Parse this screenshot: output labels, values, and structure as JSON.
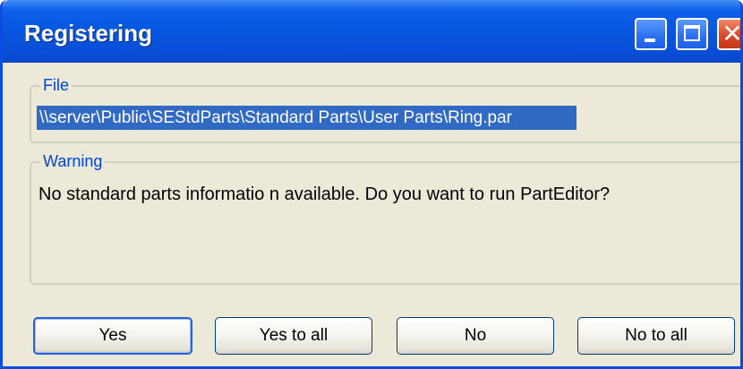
{
  "window": {
    "title": "Registering",
    "controls": {
      "minimize_icon": "minimize-icon",
      "maximize_icon": "maximize-icon",
      "close_icon": "close-icon",
      "close_glyph": "✕"
    }
  },
  "file_group": {
    "legend": "File",
    "path": "\\\\server\\Public\\SEStdParts\\Standard Parts\\User Parts\\Ring.par"
  },
  "warning_group": {
    "legend": "Warning",
    "message": "No standard parts informatio n available. Do you want to run PartEditor?"
  },
  "buttons": {
    "yes": "Yes",
    "yes_to_all": "Yes to all",
    "no": "No",
    "no_to_all": "No to all"
  },
  "colors": {
    "titlebar": "#0855dd",
    "window_bg": "#ece9d8",
    "legend_text": "#0046d5",
    "selection": "#316ac5",
    "close_button": "#d8492a"
  }
}
